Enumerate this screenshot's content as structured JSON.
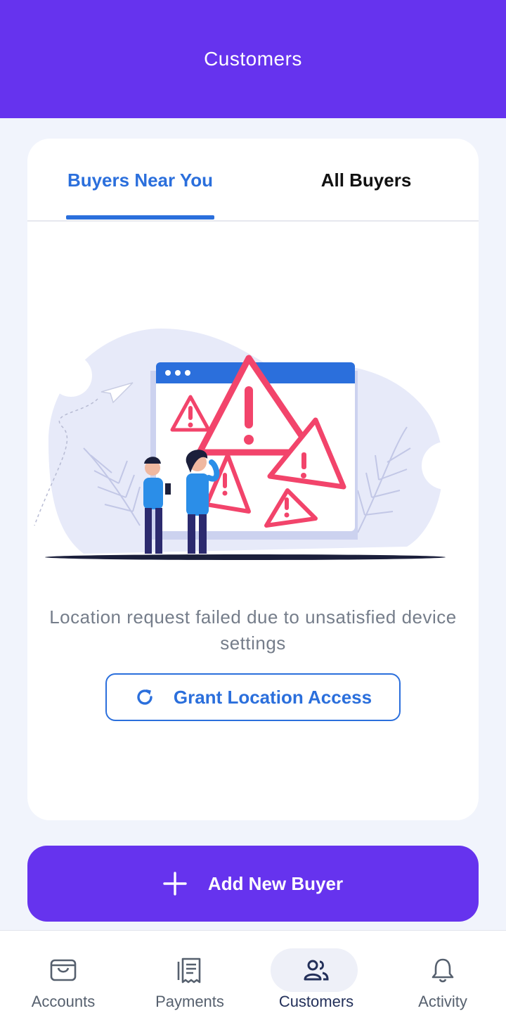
{
  "header": {
    "title": "Customers"
  },
  "tabs": [
    {
      "label": "Buyers Near You",
      "active": true
    },
    {
      "label": "All Buyers",
      "active": false
    }
  ],
  "empty_state": {
    "message_line1": "Location request failed due to unsatisfied device",
    "message_line2": "settings",
    "grant_button": {
      "label": "Grant Location Access",
      "icon": "refresh-icon"
    }
  },
  "add_button": {
    "label": "Add New Buyer",
    "icon": "plus-icon"
  },
  "bottom_nav": [
    {
      "label": "Accounts",
      "icon": "wallet-icon",
      "active": false
    },
    {
      "label": "Payments",
      "icon": "receipt-icon",
      "active": false
    },
    {
      "label": "Customers",
      "icon": "users-icon",
      "active": true
    },
    {
      "label": "Activity",
      "icon": "bell-icon",
      "active": false
    }
  ],
  "colors": {
    "brand": "#6633ee",
    "accent": "#2b6fdc",
    "alert": "#f2446b",
    "background": "#f1f4fc"
  }
}
